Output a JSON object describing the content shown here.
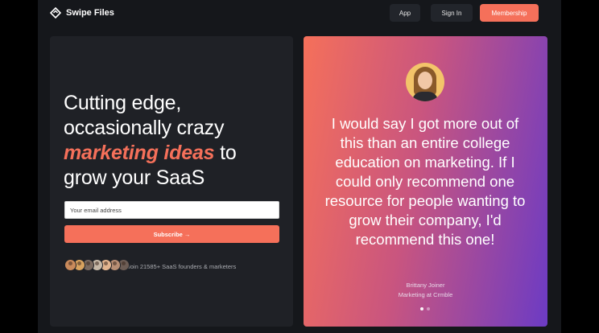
{
  "nav": {
    "brand": "Swipe Files",
    "app_label": "App",
    "signin_label": "Sign In",
    "membership_label": "Membership",
    "accent_color": "#f5705a"
  },
  "hero": {
    "line1": "Cutting edge,",
    "line2": "occasionally crazy",
    "accent": "marketing ideas",
    "line3_suffix": " to",
    "line4": "grow your SaaS"
  },
  "signup": {
    "email_placeholder": "Your email address",
    "subscribe_label": "Subscribe →",
    "social_proof": "Join 21585+ SaaS founders & marketers",
    "avatar_colors": [
      "#c98a5b",
      "#d9a35f",
      "#7a6a60",
      "#c7b9a8",
      "#e2b48f",
      "#b78e74",
      "#6d5d55"
    ]
  },
  "testimonial": {
    "quote": "I would say I got more out of this than an entire college education on marketing. If I could only recommend one resource for people wanting to grow their company, I'd recommend this one!",
    "author_name": "Brittany Joiner",
    "author_role": "Marketing at Crmble",
    "carousel_pages": 2,
    "carousel_active": 1
  }
}
